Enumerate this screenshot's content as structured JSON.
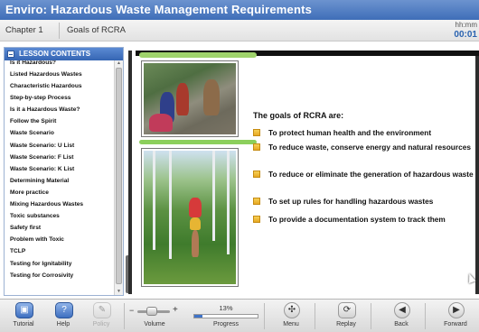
{
  "window": {
    "title": "Enviro: Hazardous Waste Management Requirements"
  },
  "chapter_bar": {
    "chapter": "Chapter 1",
    "chapter_title": "Goals of RCRA",
    "timer_format": "hh:mm",
    "timer_value": "00:01"
  },
  "sidebar": {
    "header": "LESSON CONTENTS",
    "items": [
      "Is it Hazardous?",
      "Listed Hazardous Wastes",
      "Characteristic Hazardous",
      "Step-by-step Process",
      "Is it a Hazardous Waste?",
      "Follow the Spirit",
      "Waste Scenario",
      "Waste Scenario: U List",
      "Waste Scenario: F List",
      "Waste Scenario: K List",
      "Determining Material",
      "More practice",
      "Mixing Hazardous Wastes",
      "Toxic substances",
      "Safety first",
      "Problem with Toxic",
      "TCLP",
      "Testing for Ignitability",
      "Testing for Corrosivity"
    ]
  },
  "content": {
    "heading": "The goals of RCRA are:",
    "goals": [
      "To protect human health and the environment",
      "To reduce waste, conserve energy and natural resources",
      "To reduce or eliminate the generation of hazardous waste",
      "To set up rules for handling hazardous wastes",
      "To provide a documentation system to track them"
    ]
  },
  "toolbar": {
    "tutorial": "Tutorial",
    "help": "Help",
    "policy": "Policy",
    "volume": "Volume",
    "progress_label": "Progress",
    "progress_value": "13%",
    "progress_fraction": 0.13,
    "menu": "Menu",
    "replay": "Replay",
    "back": "Back",
    "forward": "Forward"
  },
  "colors": {
    "title_bar": "#4a78c2",
    "timer": "#2a63b0",
    "bullet": "#f0bd3c",
    "progress_fill": "#3f73c8"
  },
  "icons": {
    "tutorial": "tutorial-icon",
    "help": "help-icon",
    "policy": "policy-icon",
    "menu": "menu-icon",
    "replay": "replay-icon",
    "back": "back-arrow-icon",
    "forward": "forward-arrow-icon"
  }
}
